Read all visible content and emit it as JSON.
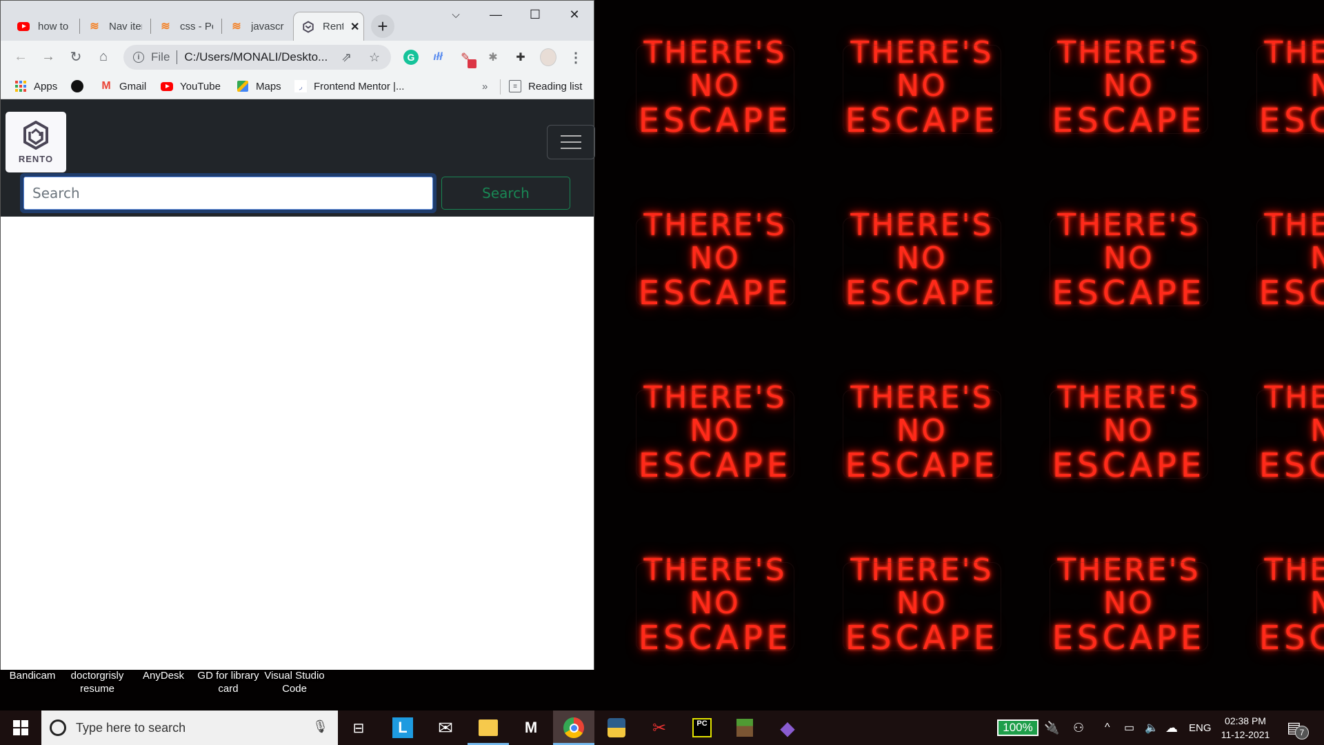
{
  "desktop": {
    "wallpaper_text": [
      "THERE'S",
      "NO",
      "ESCAPE"
    ],
    "wallpaper_color": "#ff2a1a",
    "icons": [
      {
        "label": "Bandicam"
      },
      {
        "label": "doctorgrisly resume"
      },
      {
        "label": "AnyDesk"
      },
      {
        "label": "GD for library card"
      },
      {
        "label": "Visual Studio Code"
      }
    ]
  },
  "browser": {
    "tabs": [
      {
        "title": "how to a",
        "favicon": "youtube-icon",
        "active": false
      },
      {
        "title": "Nav item",
        "favicon": "stackoverflow-icon",
        "active": false
      },
      {
        "title": "css - Po",
        "favicon": "stackoverflow-icon",
        "active": false
      },
      {
        "title": "javascrip",
        "favicon": "stackoverflow-icon",
        "active": false
      },
      {
        "title": "Rento",
        "favicon": "rento-icon",
        "active": true
      }
    ],
    "new_tab": "+",
    "tab_close": "✕",
    "window_controls": {
      "tab_search": "⌵",
      "minimize": "—",
      "maximize": "☐",
      "close": "✕"
    },
    "address": {
      "scheme_label": "File",
      "url": "C:/Users/MONALI/Deskto..."
    },
    "extensions": [
      "grammarly-icon",
      "wave-icon",
      "colorpicker-icon",
      "bug-icon",
      "puzzle-icon",
      "profile-avatar"
    ],
    "bookmarks": [
      {
        "label": "Apps",
        "icon": "apps-grid-icon"
      },
      {
        "label": "",
        "icon": "github-icon"
      },
      {
        "label": "Gmail",
        "icon": "gmail-icon"
      },
      {
        "label": "YouTube",
        "icon": "youtube-icon"
      },
      {
        "label": "Maps",
        "icon": "maps-icon"
      },
      {
        "label": "Frontend Mentor |...",
        "icon": "frontend-mentor-icon"
      }
    ],
    "bookmarks_overflow": "»",
    "reading_list": "Reading list"
  },
  "page": {
    "brand": "RENTO",
    "search": {
      "placeholder": "Search",
      "value": ""
    },
    "search_button": "Search",
    "colors": {
      "navbar_bg": "#212529",
      "search_btn": "#198754"
    }
  },
  "taskbar": {
    "search_placeholder": "Type here to search",
    "apps": [
      "task-view",
      "l-app",
      "mail",
      "file-explorer",
      "m-app",
      "chrome",
      "python-idle",
      "snipping-tool",
      "pycharm",
      "minecraft",
      "purple-app"
    ],
    "battery": "100%",
    "language": "ENG",
    "time": "02:38 PM",
    "date": "11-12-2021",
    "notifications": "7"
  }
}
